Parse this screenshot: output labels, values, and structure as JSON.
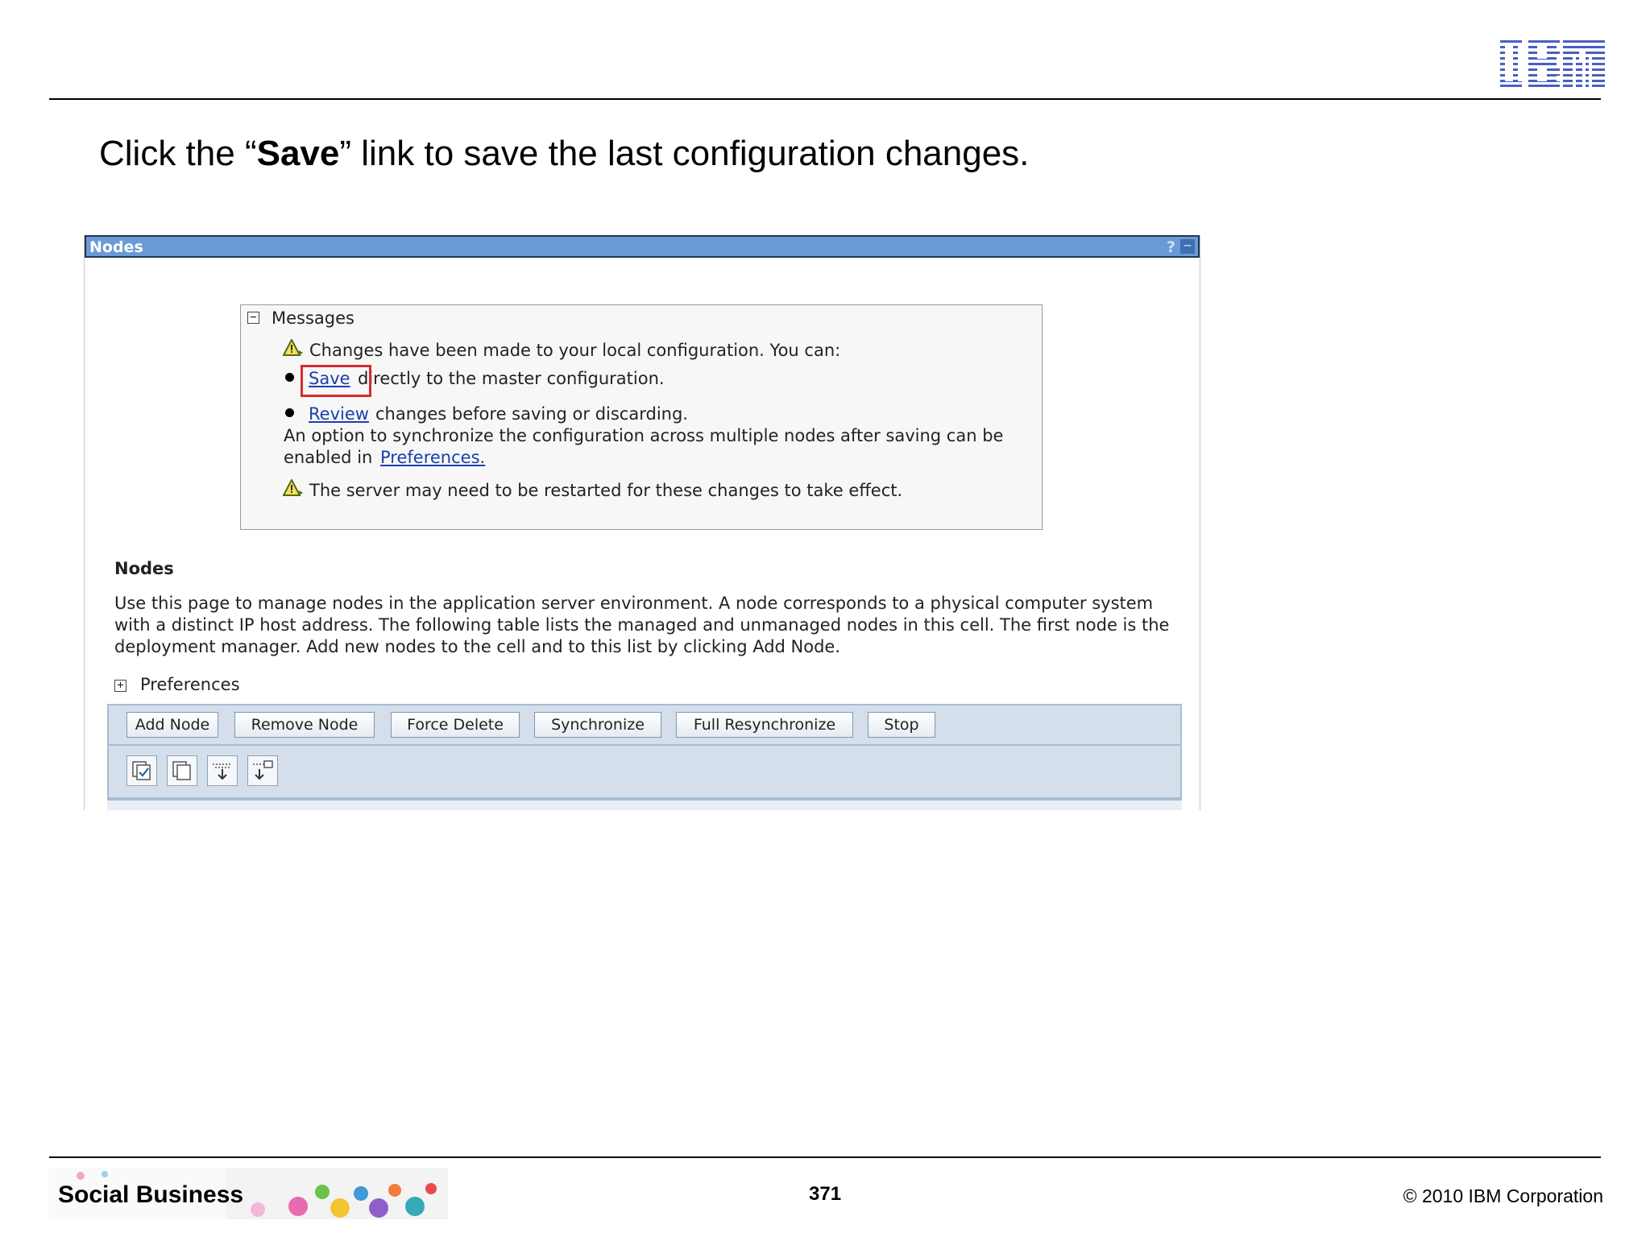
{
  "slide": {
    "headline_before": "Click the “",
    "headline_bold": "Save",
    "headline_after": "” link to save the last configuration changes.",
    "logo_text": "IBM"
  },
  "panel": {
    "title": "Nodes",
    "help_label": "?",
    "minimize_label": "–",
    "messages": {
      "title": "Messages",
      "line1": "Changes have been made to your local configuration. You can:",
      "save_link": "Save",
      "save_rest": "directly to the master configuration.",
      "review_link": "Review",
      "review_rest": "changes before saving or discarding.",
      "sync_line1": "An option to synchronize the configuration across multiple nodes after saving can be",
      "sync_line2_prefix": "enabled in",
      "preferences_link": "Preferences.",
      "line_restart": "The server may need to be restarted for these changes to take effect."
    },
    "nodes_heading": "Nodes",
    "nodes_description": "Use this page to manage nodes in the application server environment. A node corresponds to a physical computer system with a distinct IP host address. The following table lists the managed and unmanaged nodes in this cell. The first node is the deployment manager. Add new nodes to the cell and to this list by clicking Add Node.",
    "preferences_label": "Preferences",
    "buttons": {
      "add_node": "Add Node",
      "remove_node": "Remove Node",
      "force_delete": "Force Delete",
      "synchronize": "Synchronize",
      "full_resync": "Full Resynchronize",
      "stop": "Stop"
    },
    "toolbar_icons": [
      "select-all-icon",
      "deselect-all-icon",
      "show-filter-icon",
      "clear-filter-icon"
    ]
  },
  "footer": {
    "brand": "Social Business",
    "page_number": "371",
    "copyright": "© 2010 IBM Corporation"
  },
  "colors": {
    "title_bar": "#6a9bd6",
    "link": "#1a3fb0",
    "highlight": "#d62c2c",
    "ibm_blue": "#4a5fc1",
    "toolbar_bg": "#d4dfeb"
  }
}
